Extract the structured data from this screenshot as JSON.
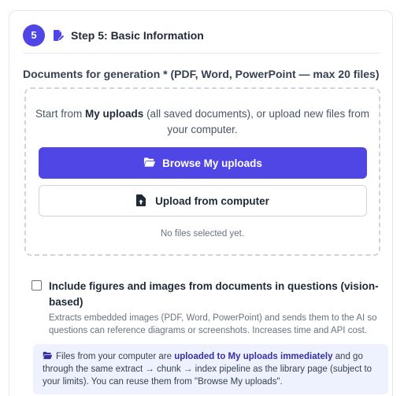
{
  "step": {
    "number": "5",
    "title": "Step 5: Basic Information",
    "icon": "file-edit-icon"
  },
  "documents": {
    "label": "Documents for generation * (PDF, Word, PowerPoint — max 20 files)",
    "intro_prefix": "Start from ",
    "intro_bold": "My uploads",
    "intro_suffix": " (all saved documents), or upload new files from your computer.",
    "browse_label": "Browse My uploads",
    "browse_icon": "folder-open-icon",
    "upload_label": "Upload from computer",
    "upload_icon": "file-upload-icon",
    "status": "No files selected yet."
  },
  "vision": {
    "checked": false,
    "label": "Include figures and images from documents in questions (vision-based)",
    "description": "Extracts embedded images (PDF, Word, PowerPoint) and sends them to the AI so questions can reference diagrams or screenshots. Increases time and API cost."
  },
  "info": {
    "icon": "folder-open-icon",
    "prefix": "Files from your computer are ",
    "bold": "uploaded to My uploads immediately",
    "suffix": " and go through the same extract → chunk → index pipeline as the library page (subject to your limits). You can reuse them from \"Browse My uploads\"."
  },
  "colors": {
    "accent": "#4f46e5",
    "info_bg": "#eef2ff"
  }
}
